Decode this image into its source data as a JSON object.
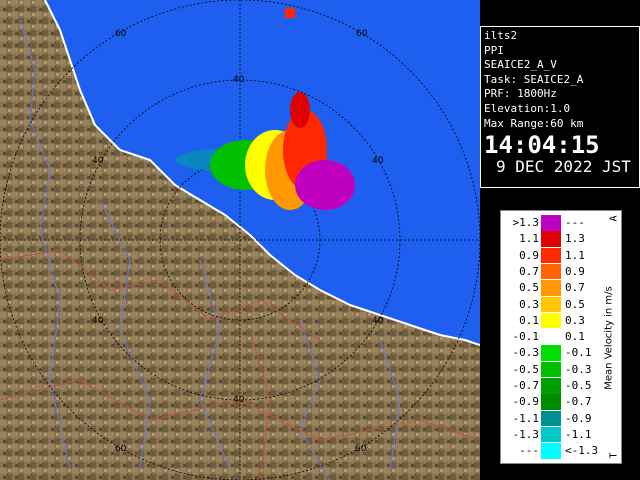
{
  "info": {
    "site": "ilts2",
    "mode": "PPI",
    "product": "SEAICE2_A_V",
    "task": "Task: SEAICE2_A",
    "prf": "PRF: 1800Hz",
    "elevation": "Elevation:1.0",
    "max_range": "Max Range:60 km",
    "time": "14:04:15",
    "date": "9 DEC 2022 JST"
  },
  "range_labels": [
    "60",
    "40",
    "40",
    "40",
    "40",
    "40",
    "60",
    "60",
    "60"
  ],
  "legend": {
    "title": "Mean Velocity in m/s",
    "corner_top": "A",
    "corner_bottom": "T",
    "rows": [
      {
        "lo": ">1.3",
        "hi": "---",
        "color": "#c000c0"
      },
      {
        "lo": "1.1",
        "hi": "1.3",
        "color": "#e00000"
      },
      {
        "lo": "0.9",
        "hi": "1.1",
        "color": "#ff2800"
      },
      {
        "lo": "0.7",
        "hi": "0.9",
        "color": "#ff6400"
      },
      {
        "lo": "0.5",
        "hi": "0.7",
        "color": "#ff9800"
      },
      {
        "lo": "0.3",
        "hi": "0.5",
        "color": "#ffc800"
      },
      {
        "lo": "0.1",
        "hi": "0.3",
        "color": "#ffff00"
      },
      {
        "lo": "-0.1",
        "hi": "0.1",
        "color": "#ffffff"
      },
      {
        "lo": "-0.3",
        "hi": "-0.1",
        "color": "#00e000"
      },
      {
        "lo": "-0.5",
        "hi": "-0.3",
        "color": "#00c000"
      },
      {
        "lo": "-0.7",
        "hi": "-0.5",
        "color": "#00a000"
      },
      {
        "lo": "-0.9",
        "hi": "-0.7",
        "color": "#008c00"
      },
      {
        "lo": "-1.1",
        "hi": "-0.9",
        "color": "#009090"
      },
      {
        "lo": "-1.3",
        "hi": "-1.1",
        "color": "#00c8c8"
      },
      {
        "lo": "---",
        "hi": "<-1.3",
        "color": "#00ffff"
      }
    ]
  },
  "colors": {
    "sea": "#1e5ff0",
    "land": "#8a7450",
    "land_dark": "#5a4a32",
    "coast": "#ffffff"
  }
}
